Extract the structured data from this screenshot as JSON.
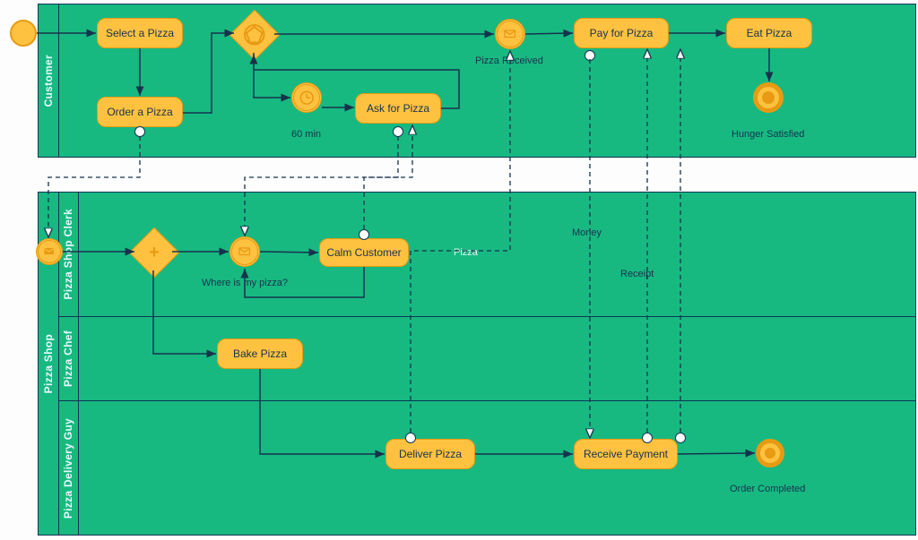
{
  "pools": {
    "customer": {
      "title": "Customer"
    },
    "shop": {
      "title": "Pizza Shop",
      "lanes": {
        "clerk": "Pizza Shop Clerk",
        "chef": "Pizza Chef",
        "delivery": "Pizza Delivery Guy"
      }
    }
  },
  "tasks": {
    "select": "Select a Pizza",
    "order": "Order a Pizza",
    "ask": "Ask for Pizza",
    "pay": "Pay for Pizza",
    "eat": "Eat Pizza",
    "calm": "Calm Customer",
    "bake": "Bake Pizza",
    "deliver": "Deliver Pizza",
    "receive": "Receive Payment"
  },
  "events": {
    "timer_label": "60 min",
    "msg_received": "Pizza Received",
    "where": "Where is my pizza?",
    "hunger": "Hunger Satisfied",
    "order_done": "Order Completed"
  },
  "messages": {
    "pizza": "Pizza",
    "money": "Money",
    "receipt": "Receipt"
  }
}
